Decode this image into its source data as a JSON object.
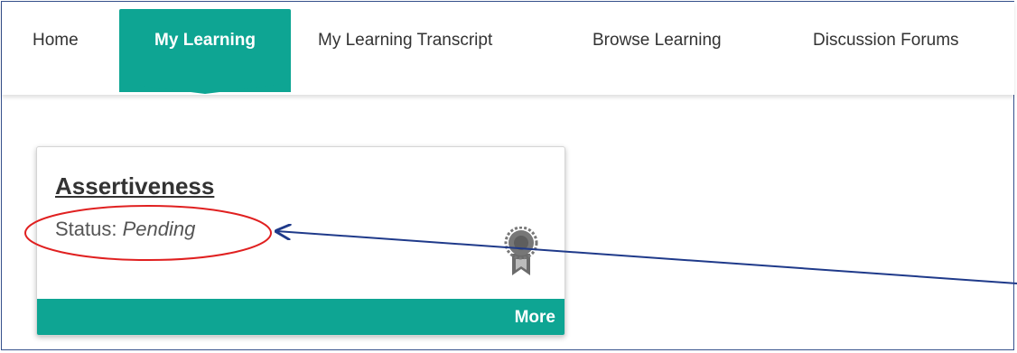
{
  "nav": {
    "items": [
      {
        "label": "Home",
        "active": false
      },
      {
        "label": "My Learning",
        "active": true
      },
      {
        "label": "My Learning Transcript",
        "active": false
      },
      {
        "label": "Browse Learning",
        "active": false
      },
      {
        "label": "Discussion Forums",
        "active": false
      }
    ],
    "accent_color": "#0ea593"
  },
  "card": {
    "title": "Assertiveness",
    "status_label": "Status:",
    "status_value": "Pending",
    "badge_icon": "award-ribbon-icon",
    "footer_label": "More"
  },
  "annotation": {
    "ellipse_color": "#e02020",
    "arrow_color": "#1f3a8a"
  }
}
